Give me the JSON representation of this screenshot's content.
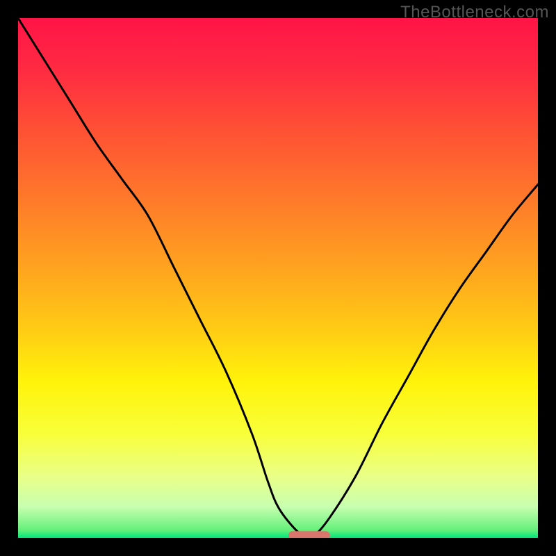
{
  "watermark": "TheBottleneck.com",
  "colors": {
    "frame": "#000000",
    "curve": "#000000",
    "marker": "#d9756c",
    "watermark": "#555555"
  },
  "gradient_stops": [
    {
      "offset": 0.0,
      "color": "#ff1447"
    },
    {
      "offset": 0.1,
      "color": "#ff2b42"
    },
    {
      "offset": 0.22,
      "color": "#ff5234"
    },
    {
      "offset": 0.35,
      "color": "#ff7a2a"
    },
    {
      "offset": 0.48,
      "color": "#ffa31f"
    },
    {
      "offset": 0.6,
      "color": "#ffcc14"
    },
    {
      "offset": 0.7,
      "color": "#fff30a"
    },
    {
      "offset": 0.8,
      "color": "#f8ff3a"
    },
    {
      "offset": 0.88,
      "color": "#eaff86"
    },
    {
      "offset": 0.94,
      "color": "#c8ffb0"
    },
    {
      "offset": 0.985,
      "color": "#64f07a"
    },
    {
      "offset": 1.0,
      "color": "#00e57a"
    }
  ],
  "chart_data": {
    "type": "line",
    "title": "",
    "xlabel": "",
    "ylabel": "",
    "xlim": [
      0,
      100
    ],
    "ylim": [
      0,
      100
    ],
    "x": [
      0,
      5,
      10,
      15,
      20,
      25,
      30,
      35,
      40,
      45,
      48,
      50,
      53,
      55,
      57,
      60,
      65,
      70,
      75,
      80,
      85,
      90,
      95,
      100
    ],
    "values": [
      100,
      92,
      84,
      76,
      69,
      62,
      52,
      42,
      32,
      20,
      11,
      6,
      2,
      0.5,
      0.5,
      4,
      12,
      22,
      31,
      40,
      48,
      55,
      62,
      68
    ],
    "optimum_marker": {
      "x_start": 52,
      "x_end": 60,
      "y": 0.5
    }
  }
}
